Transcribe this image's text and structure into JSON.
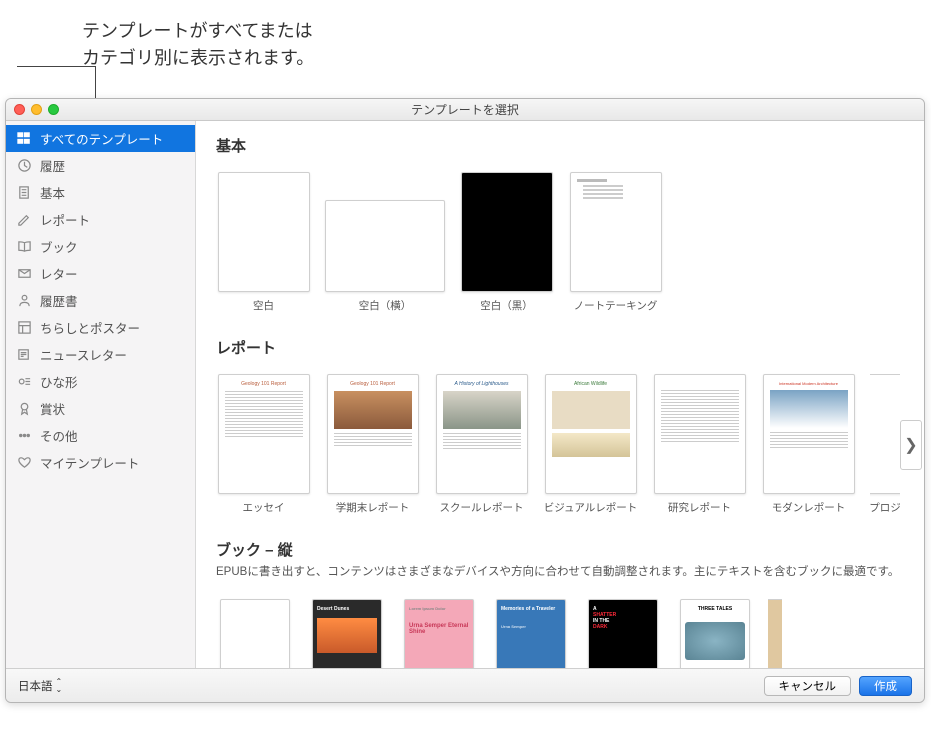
{
  "annotation": {
    "text": "テンプレートがすべてまたは\nカテゴリ別に表示されます。"
  },
  "window": {
    "title": "テンプレートを選択"
  },
  "sidebar": {
    "items": [
      {
        "icon": "grid",
        "label": "すべてのテンプレート",
        "selected": true
      },
      {
        "icon": "clock",
        "label": "履歴"
      },
      {
        "icon": "doc",
        "label": "基本"
      },
      {
        "icon": "pencil",
        "label": "レポート"
      },
      {
        "icon": "book",
        "label": "ブック"
      },
      {
        "icon": "mail",
        "label": "レター"
      },
      {
        "icon": "person",
        "label": "履歴書"
      },
      {
        "icon": "layout",
        "label": "ちらしとポスター"
      },
      {
        "icon": "news",
        "label": "ニュースレター"
      },
      {
        "icon": "card",
        "label": "ひな形"
      },
      {
        "icon": "ribbon",
        "label": "賞状"
      },
      {
        "icon": "dots",
        "label": "その他"
      },
      {
        "icon": "heart",
        "label": "マイテンプレート"
      }
    ]
  },
  "sections": {
    "basic": {
      "title": "基本",
      "templates": [
        {
          "label": "空白",
          "kind": "blank"
        },
        {
          "label": "空白（横）",
          "kind": "blank-landscape"
        },
        {
          "label": "空白（黒）",
          "kind": "blank-black"
        },
        {
          "label": "ノートテーキング",
          "kind": "notetaking"
        }
      ]
    },
    "report": {
      "title": "レポート",
      "templates": [
        {
          "label": "エッセイ",
          "thumb_title": "Geology 101 Report"
        },
        {
          "label": "学期末レポート",
          "thumb_title": "Geology 101 Report"
        },
        {
          "label": "スクールレポート",
          "thumb_title": "A History of Lighthouses"
        },
        {
          "label": "ビジュアルレポート",
          "thumb_title": "African Wildlife"
        },
        {
          "label": "研究レポート",
          "thumb_title": ""
        },
        {
          "label": "モダンレポート",
          "thumb_title": "International Modern Architecture"
        },
        {
          "label": "プロジ"
        }
      ]
    },
    "book": {
      "title": "ブック – 縦",
      "description": "EPUBに書き出すと、コンテンツはさまざまなデバイスや方向に合わせて自動調整されます。主にテキストを含むブックに最適です。",
      "templates": [
        {
          "label": "",
          "thumb_title": ""
        },
        {
          "label": "",
          "thumb_title": "Desert Dunes"
        },
        {
          "label": "",
          "thumb_title": "Urna Semper Eternal Shine"
        },
        {
          "label": "",
          "thumb_title": "Memories of a Traveler"
        },
        {
          "label": "",
          "thumb_title": "A SHATTER IN THE DARK"
        },
        {
          "label": "",
          "thumb_title": "THREE TALES"
        }
      ]
    }
  },
  "footer": {
    "language": "日本語",
    "cancel": "キャンセル",
    "create": "作成"
  }
}
